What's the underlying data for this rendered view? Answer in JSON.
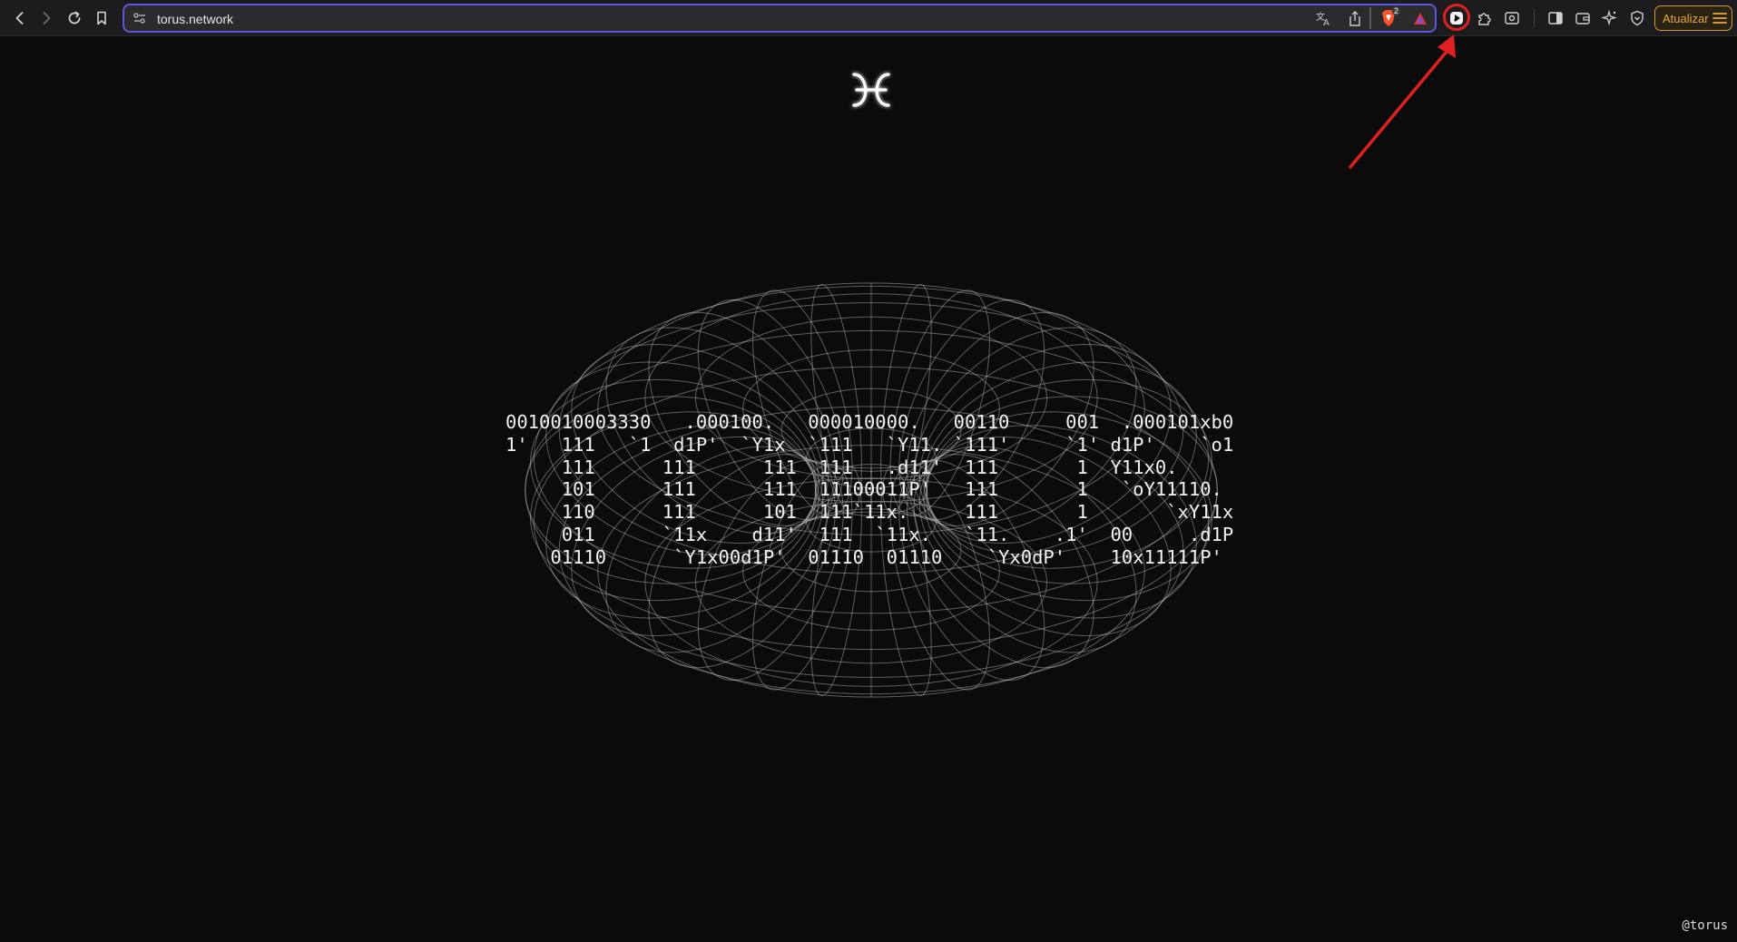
{
  "browser": {
    "url": "torus.network",
    "update_button_label": "Atualizar",
    "brave_shield_badge": "2",
    "accent_color": "#5b56e0",
    "update_color": "#e6a93a",
    "icons": {
      "back": "chevron-left-icon",
      "forward": "chevron-right-icon",
      "reload": "reload-icon",
      "bookmark": "bookmark-icon",
      "site_info": "site-settings-icon",
      "translate": "translate-icon",
      "share": "share-icon",
      "brave_shields": "brave-shield-icon",
      "brave_rewards": "brave-rewards-icon",
      "extension_highlighted": "extension-icon",
      "extensions": "puzzle-icon",
      "screenshot": "screenshot-icon",
      "sidebar": "sidebar-icon",
      "wallet": "wallet-icon",
      "leo": "leo-ai-icon",
      "vpn": "vpn-icon",
      "menu": "hamburger-menu-icon"
    }
  },
  "page": {
    "ascii_art": [
      "0010010003330   .000100.   000010000.   00110     001  .000101xb0",
      "1'   111   `1  d1P'  `Y1x  `111   `Y11. `111'     `1' d1P'    `o1",
      "     111      111      111  111   .d11'  111       1  Y11x0.",
      "     101      111      111  11100011P'   111       1   `oY11110.",
      "     110      111      101  111`11x.     111       1       `xY11x",
      "     011      `11x    d11'  111  `11x.   `11.    .1'  00     .d1P",
      "    01110      `Y1x00d1P'  01110  01110    `Yx0dP'    10x11111P'"
    ],
    "footer_handle": "@torus"
  },
  "annotation": {
    "color": "#e02020"
  }
}
